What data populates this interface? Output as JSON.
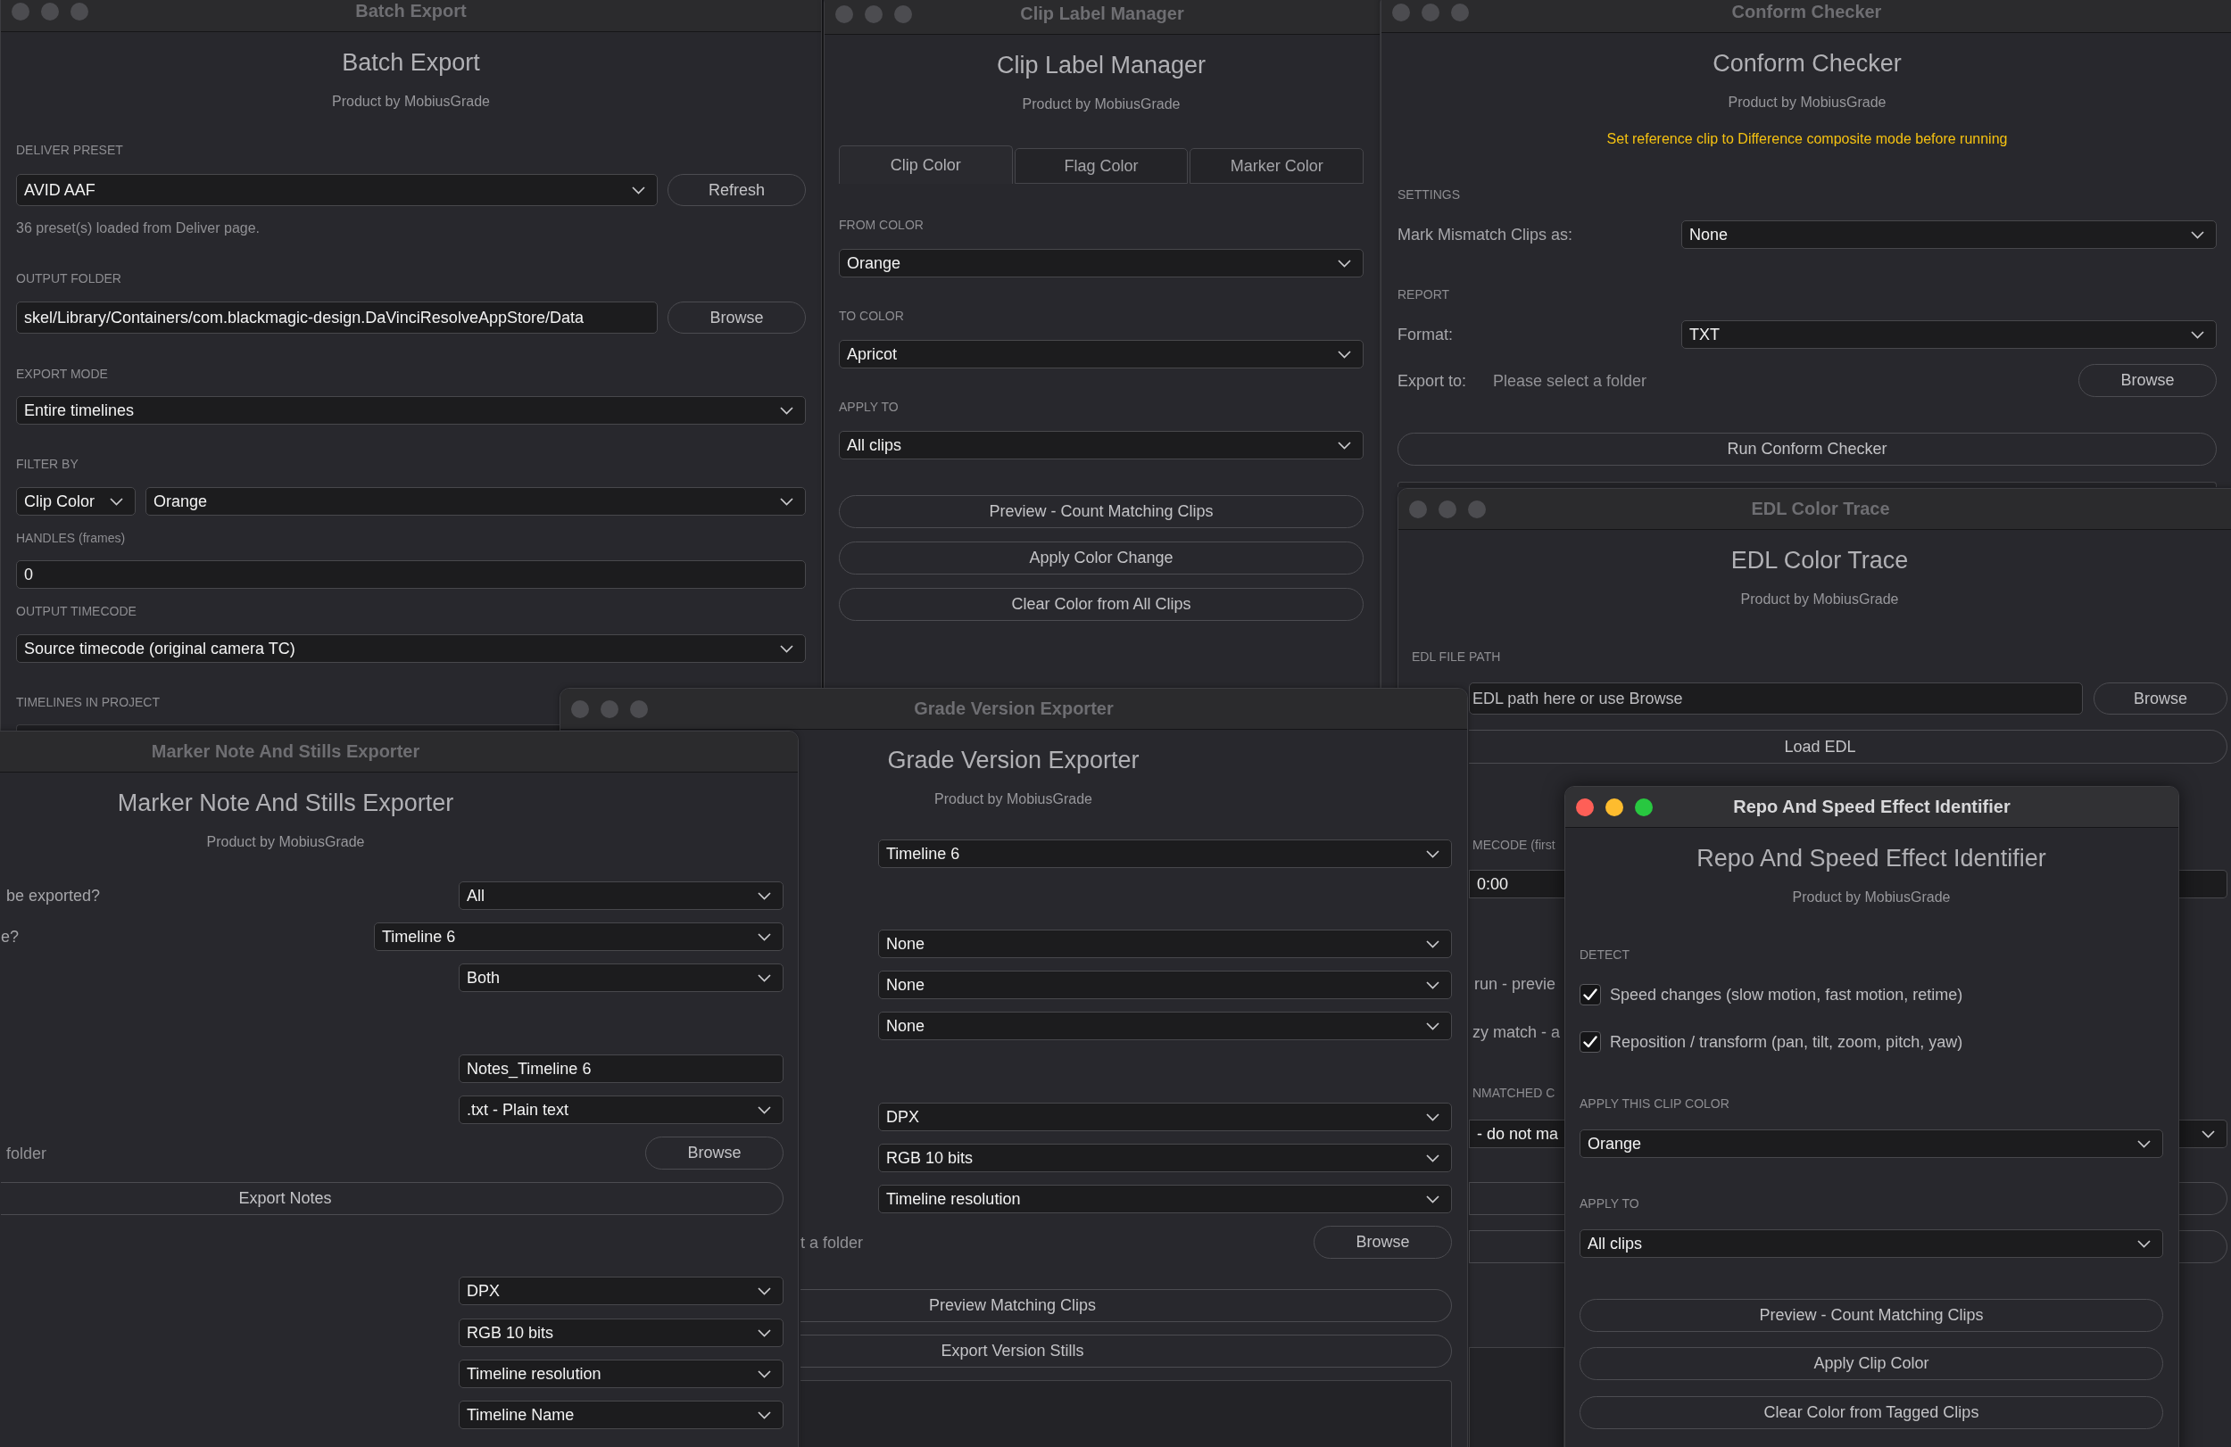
{
  "windows": [
    {
      "title": "Batch Export",
      "active": false,
      "heading": "Batch Export",
      "subtitle": "Product by MobiusGrade",
      "rows": [
        {
          "kind": "section",
          "text": "DELIVER PRESET"
        },
        {
          "kind": "select_button",
          "value": "AVID AAF",
          "button": "Refresh"
        },
        {
          "kind": "note",
          "text": "36 preset(s) loaded from Deliver page."
        },
        {
          "kind": "section",
          "text": "OUTPUT FOLDER"
        },
        {
          "kind": "input_button",
          "value": "skel/Library/Containers/com.blackmagic-design.DaVinciResolveAppStore/Data",
          "button": "Browse"
        },
        {
          "kind": "section",
          "text": "EXPORT MODE"
        },
        {
          "kind": "select",
          "value": "Entire timelines"
        },
        {
          "kind": "section",
          "text": "FILTER BY"
        },
        {
          "kind": "select_pair",
          "values": [
            "Clip Color",
            "Orange"
          ]
        },
        {
          "kind": "section",
          "text": "HANDLES (frames)"
        },
        {
          "kind": "input",
          "value": "0"
        },
        {
          "kind": "section",
          "text": "OUTPUT TIMECODE"
        },
        {
          "kind": "select",
          "value": "Source timecode (original camera TC)"
        },
        {
          "kind": "section",
          "text": "TIMELINES IN PROJECT"
        },
        {
          "kind": "list"
        }
      ]
    },
    {
      "title": "Clip Label Manager",
      "active": false,
      "heading": "Clip Label Manager",
      "subtitle": "Product by MobiusGrade",
      "rows": [
        {
          "kind": "tabs",
          "tabs": [
            {
              "label": "Clip Color",
              "selected": true
            },
            {
              "label": "Flag Color",
              "selected": false
            },
            {
              "label": "Marker Color",
              "selected": false
            }
          ]
        },
        {
          "kind": "section",
          "text": "FROM COLOR"
        },
        {
          "kind": "select",
          "value": "Orange"
        },
        {
          "kind": "section",
          "text": "TO COLOR"
        },
        {
          "kind": "select",
          "value": "Apricot"
        },
        {
          "kind": "section",
          "text": "APPLY TO"
        },
        {
          "kind": "select",
          "value": "All clips"
        },
        {
          "kind": "button",
          "text": "Preview - Count Matching Clips"
        },
        {
          "kind": "button",
          "text": "Apply Color Change"
        },
        {
          "kind": "button",
          "text": "Clear Color from All Clips"
        }
      ]
    },
    {
      "title": "Conform Checker",
      "active": false,
      "heading": "Conform Checker",
      "subtitle": "Product by MobiusGrade",
      "rows": [
        {
          "kind": "warning",
          "text": "Set reference clip to Difference composite mode before running"
        },
        {
          "kind": "section",
          "text": "SETTINGS"
        },
        {
          "kind": "labeled_select",
          "label": "Mark Mismatch Clips as:",
          "value": "None"
        },
        {
          "kind": "section",
          "text": "REPORT"
        },
        {
          "kind": "labeled_select",
          "label": "Format:",
          "value": "TXT"
        },
        {
          "kind": "folder_row",
          "label": "Export to:",
          "value": "Please select a folder",
          "button": "Browse"
        },
        {
          "kind": "button",
          "text": "Run Conform Checker"
        },
        {
          "kind": "text_area"
        }
      ]
    },
    {
      "title": "EDL Color Trace",
      "active": false,
      "heading": "EDL Color Trace",
      "subtitle": "Product by MobiusGrade",
      "rows": [
        {
          "kind": "section",
          "text": "EDL FILE PATH"
        },
        {
          "kind": "input_button",
          "placeholder": "EDL path here or use Browse",
          "button": "Browse"
        },
        {
          "kind": "button",
          "text": "Load EDL"
        },
        {
          "kind": "section",
          "text": "MECODE (first"
        },
        {
          "kind": "input",
          "value": "0:00"
        },
        {
          "kind": "text",
          "text": "run - previe"
        },
        {
          "kind": "text",
          "text": "zy match - a"
        },
        {
          "kind": "section",
          "text": "NMATCHED C"
        },
        {
          "kind": "select",
          "value": "- do not ma"
        },
        {
          "kind": "blank_button"
        },
        {
          "kind": "blank_button"
        },
        {
          "kind": "text_area"
        }
      ]
    },
    {
      "title": "Grade Version Exporter",
      "active": false,
      "heading": "Grade Version Exporter",
      "subtitle": "Product by MobiusGrade",
      "rows": [
        {
          "kind": "select",
          "value": "Timeline 6"
        },
        {
          "kind": "select",
          "value": "None"
        },
        {
          "kind": "select",
          "value": "None"
        },
        {
          "kind": "select",
          "value": "None"
        },
        {
          "kind": "select",
          "value": "DPX"
        },
        {
          "kind": "select",
          "value": "RGB 10 bits"
        },
        {
          "kind": "select",
          "value": "Timeline resolution"
        },
        {
          "kind": "folder_row",
          "value": "t a folder",
          "button": "Browse"
        },
        {
          "kind": "button",
          "text": "Preview Matching Clips"
        },
        {
          "kind": "button",
          "text": "Export Version Stills"
        },
        {
          "kind": "text_area"
        }
      ]
    },
    {
      "title": "Marker Note And Stills Exporter",
      "active": false,
      "heading": "Marker Note And Stills Exporter",
      "subtitle": "Product by MobiusGrade",
      "rows": [
        {
          "kind": "labeled_select",
          "label": "be exported?",
          "value": "All"
        },
        {
          "kind": "labeled_select",
          "label": "e?",
          "value": "Timeline 6"
        },
        {
          "kind": "select",
          "value": "Both"
        },
        {
          "kind": "input",
          "value": "Notes_Timeline 6"
        },
        {
          "kind": "select",
          "value": ".txt - Plain text"
        },
        {
          "kind": "folder_row",
          "value": "folder",
          "button": "Browse"
        },
        {
          "kind": "button",
          "text": "Export Notes"
        },
        {
          "kind": "select",
          "value": "DPX"
        },
        {
          "kind": "select",
          "value": "RGB 10 bits"
        },
        {
          "kind": "select",
          "value": "Timeline resolution"
        },
        {
          "kind": "select",
          "value": "Timeline Name"
        }
      ]
    },
    {
      "title": "Repo And Speed Effect Identifier",
      "active": true,
      "heading": "Repo And Speed Effect Identifier",
      "subtitle": "Product by MobiusGrade",
      "rows": [
        {
          "kind": "section",
          "text": "DETECT"
        },
        {
          "kind": "checkbox",
          "label": "Speed changes (slow motion, fast motion, retime)",
          "checked": true
        },
        {
          "kind": "checkbox",
          "label": "Reposition / transform (pan, tilt, zoom, pitch, yaw)",
          "checked": true
        },
        {
          "kind": "section",
          "text": "APPLY THIS CLIP COLOR"
        },
        {
          "kind": "select",
          "value": "Orange"
        },
        {
          "kind": "section",
          "text": "APPLY TO"
        },
        {
          "kind": "select",
          "value": "All clips"
        },
        {
          "kind": "button",
          "text": "Preview - Count Matching Clips"
        },
        {
          "kind": "button",
          "text": "Apply Clip Color"
        },
        {
          "kind": "button",
          "text": "Clear Color from Tagged Clips"
        }
      ]
    }
  ]
}
